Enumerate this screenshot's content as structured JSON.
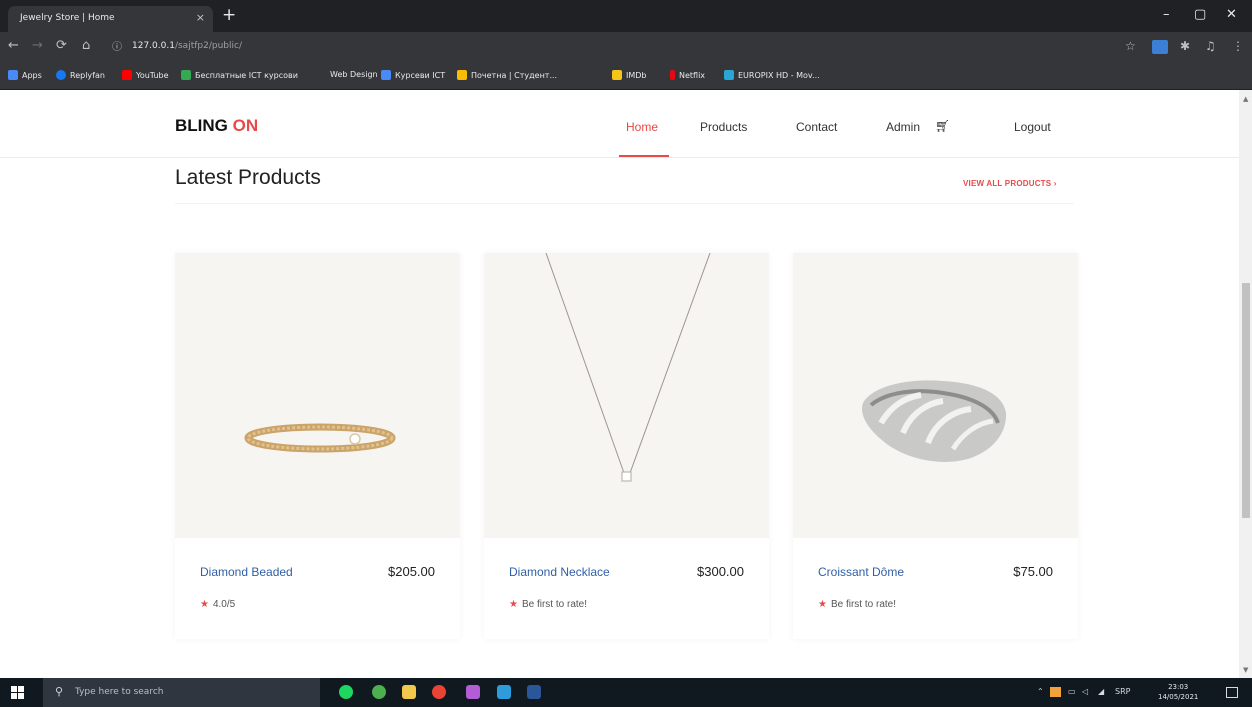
{
  "browser": {
    "tab_title": "Jewelry Store | Home",
    "tab_close": "×",
    "new_tab": "+",
    "url_host": "127.0.0.1",
    "url_path": "/sajtfp2/public/",
    "window": {
      "minimize": "–",
      "maximize": "▢",
      "close": "✕"
    },
    "bookmarks": [
      {
        "label": "Apps",
        "color": "#4a8af4"
      },
      {
        "label": "Replyfan",
        "color": "#1877f2"
      },
      {
        "label": "YouTube",
        "color": "#ff0000"
      },
      {
        "label": "Бесплатные ICT курсови",
        "color": "#34a853"
      },
      {
        "label": "Web Design",
        "color": ""
      },
      {
        "label": "Курсеви ICT",
        "color": "#4a8af4"
      },
      {
        "label": "Почетна | Студент...",
        "color": "#fbbc04"
      },
      {
        "label": "IMDb",
        "color": "#f5c518"
      },
      {
        "label": "Netflix",
        "color": "#e50914"
      },
      {
        "label": "EUROPIX HD - Mov...",
        "color": "#2aa6d6"
      }
    ]
  },
  "site": {
    "logo_main": "BLING",
    "logo_accent": "ON",
    "nav": [
      "Home",
      "Products",
      "Contact",
      "Admin",
      "Logout"
    ],
    "cart_icon": "cart-icon",
    "section_title": "Latest Products",
    "view_all": "VIEW ALL PRODUCTS ›",
    "products": [
      {
        "name": "Diamond Beaded",
        "price": "$205.00",
        "rating_text": "4.0/5",
        "image": "bracelet"
      },
      {
        "name": "Diamond Necklace",
        "price": "$300.00",
        "rating_text": "Be first to rate!",
        "image": "necklace"
      },
      {
        "name": "Croissant Dôme",
        "price": "$75.00",
        "rating_text": "Be first to rate!",
        "image": "ring"
      }
    ],
    "colors": {
      "accent": "#e84a4a",
      "link": "#2f5fa6",
      "card_bg": "#f7f5f1"
    }
  },
  "taskbar": {
    "search_placeholder": "Type here to search",
    "language": "SRP",
    "time": "23:03",
    "date": "14/05/2021"
  }
}
